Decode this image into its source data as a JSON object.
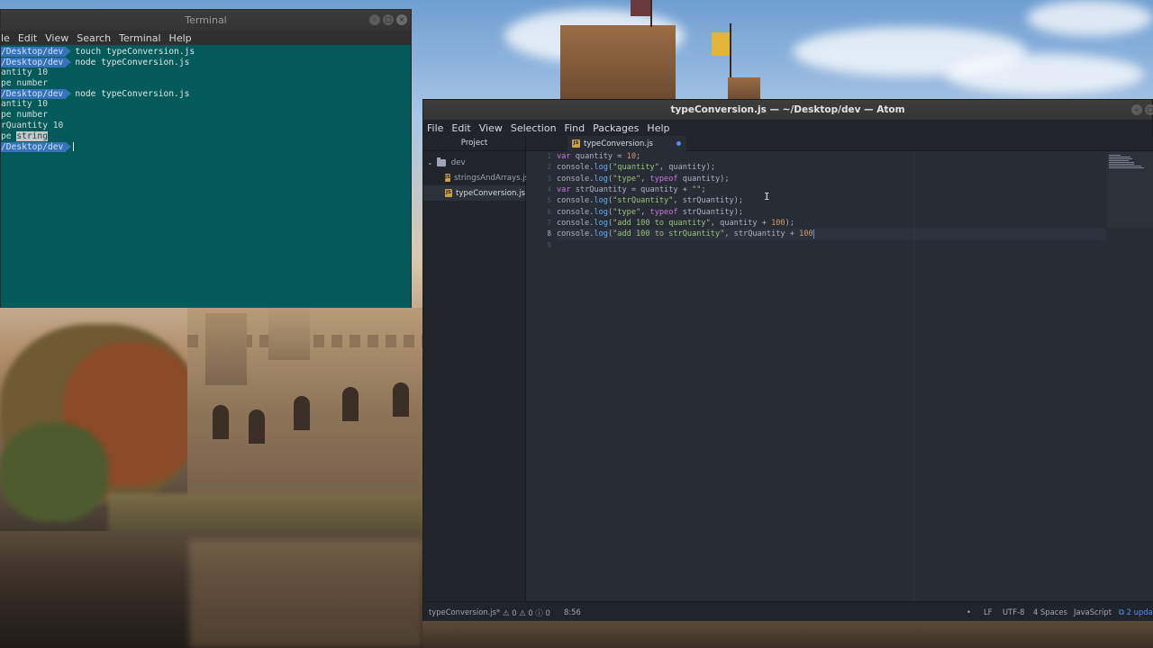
{
  "terminal": {
    "title": "Terminal",
    "menu": [
      "le",
      "Edit",
      "View",
      "Search",
      "Terminal",
      "Help"
    ],
    "lines": [
      {
        "kind": "prompt",
        "prompt": "/Desktop/dev",
        "command": "touch typeConversion.js"
      },
      {
        "kind": "prompt",
        "prompt": "/Desktop/dev",
        "command": "node typeConversion.js"
      },
      {
        "kind": "output",
        "text": "antity 10"
      },
      {
        "kind": "output",
        "text": "pe number"
      },
      {
        "kind": "prompt",
        "prompt": "/Desktop/dev",
        "command": "node typeConversion.js"
      },
      {
        "kind": "output",
        "text": "antity 10"
      },
      {
        "kind": "output",
        "text": "pe number"
      },
      {
        "kind": "output",
        "text": "rQuantity 10"
      },
      {
        "kind": "output-hl",
        "text": "pe ",
        "highlight": "string"
      },
      {
        "kind": "prompt-cursor",
        "prompt": "/Desktop/dev",
        "command": ""
      }
    ]
  },
  "atom": {
    "title": "typeConversion.js — ~/Desktop/dev — Atom",
    "menu": [
      "File",
      "Edit",
      "View",
      "Selection",
      "Find",
      "Packages",
      "Help"
    ],
    "tree": {
      "header": "Project",
      "root": "dev",
      "files": [
        "stringsAndArrays.js",
        "typeConversion.js"
      ],
      "selected_index": 1
    },
    "tab": {
      "label": "typeConversion.js",
      "modified": true
    },
    "line_numbers": [
      "1",
      "2",
      "3",
      "4",
      "5",
      "6",
      "7",
      "8",
      "9"
    ],
    "active_line": 8,
    "code_lines": [
      "var quantity = 10;",
      "console.log(\"quantity\", quantity);",
      "console.log(\"type\", typeof quantity);",
      "var strQuantity = quantity + \"\";",
      "console.log(\"strQuantity\", strQuantity);",
      "console.log(\"type\", typeof strQuantity);",
      "console.log(\"add 100 to quantity\", quantity + 100);",
      "console.log(\"add 100 to strQuantity\", strQuantity + 100",
      ""
    ],
    "status": {
      "file": "typeConversion.js*",
      "errors": "0",
      "warnings": "0",
      "infos": "0",
      "cursor_pos": "8:56",
      "line_ending": "LF",
      "encoding": "UTF-8",
      "indent": "4 Spaces",
      "grammar": "JavaScript",
      "updates": "2 upda"
    }
  },
  "colors": {
    "terminal_bg": "#0a5a5c",
    "prompt_bg": "#3573b8",
    "atom_bg": "#282c34",
    "atom_panel": "#21252b",
    "accent": "#568af2"
  }
}
